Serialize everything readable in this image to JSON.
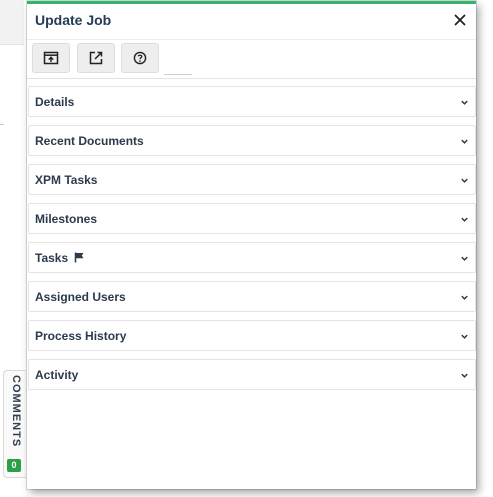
{
  "panel": {
    "title": "Update Job",
    "accent_color": "#2fb36d"
  },
  "toolbar": {
    "buttons": [
      {
        "icon": "open-in-window-icon"
      },
      {
        "icon": "external-link-icon"
      },
      {
        "icon": "help-icon"
      }
    ]
  },
  "sections": [
    {
      "label": "Details"
    },
    {
      "label": "Recent Documents"
    },
    {
      "label": "XPM Tasks"
    },
    {
      "label": "Milestones"
    },
    {
      "label": "Tasks",
      "icon": "flag-icon"
    },
    {
      "label": "Assigned Users"
    },
    {
      "label": "Process History"
    },
    {
      "label": "Activity"
    }
  ],
  "comments": {
    "label": "COMMENTS",
    "count": "0",
    "badge_color": "#2e9e48"
  }
}
